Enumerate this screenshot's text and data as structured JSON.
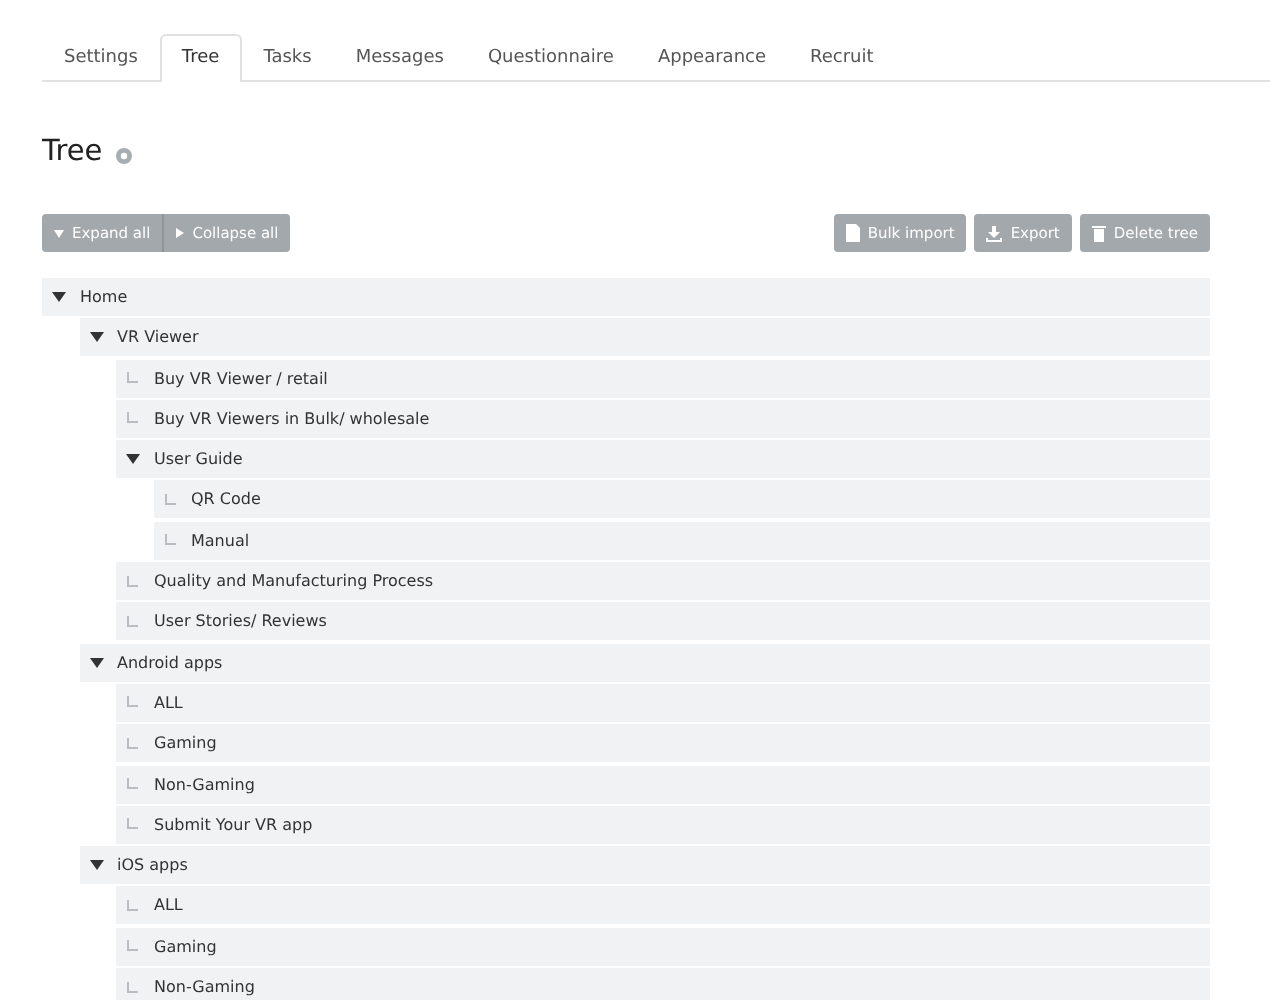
{
  "tabs": [
    {
      "label": "Settings",
      "selected": false
    },
    {
      "label": "Tree",
      "selected": true
    },
    {
      "label": "Tasks",
      "selected": false
    },
    {
      "label": "Messages",
      "selected": false
    },
    {
      "label": "Questionnaire",
      "selected": false
    },
    {
      "label": "Appearance",
      "selected": false
    },
    {
      "label": "Recruit",
      "selected": false
    }
  ],
  "title": "Tree",
  "left_buttons": [
    {
      "label": "Expand all",
      "kind": "expand"
    },
    {
      "label": "Collapse all",
      "kind": "collapse"
    }
  ],
  "right_buttons": [
    {
      "label": "Bulk import",
      "kind": "import"
    },
    {
      "label": "Export",
      "kind": "export"
    },
    {
      "label": "Delete tree",
      "kind": "delete"
    }
  ],
  "tree": [
    {
      "label": "Home",
      "expanded": true,
      "children": [
        {
          "label": "VR Viewer",
          "expanded": true,
          "children": [
            {
              "label": "Buy VR Viewer / retail"
            },
            {
              "label": "Buy VR Viewers in Bulk/ wholesale"
            },
            {
              "label": "User Guide",
              "expanded": true,
              "children": [
                {
                  "label": "QR Code"
                },
                {
                  "label": "Manual"
                }
              ]
            },
            {
              "label": "Quality and Manufacturing Process"
            },
            {
              "label": "User Stories/ Reviews"
            }
          ]
        },
        {
          "label": "Android apps",
          "expanded": true,
          "children": [
            {
              "label": "ALL"
            },
            {
              "label": "Gaming"
            },
            {
              "label": "Non-Gaming"
            },
            {
              "label": "Submit Your VR app"
            }
          ]
        },
        {
          "label": "iOS apps",
          "expanded": true,
          "children": [
            {
              "label": "ALL"
            },
            {
              "label": "Gaming"
            },
            {
              "label": "Non-Gaming"
            }
          ]
        }
      ]
    }
  ]
}
